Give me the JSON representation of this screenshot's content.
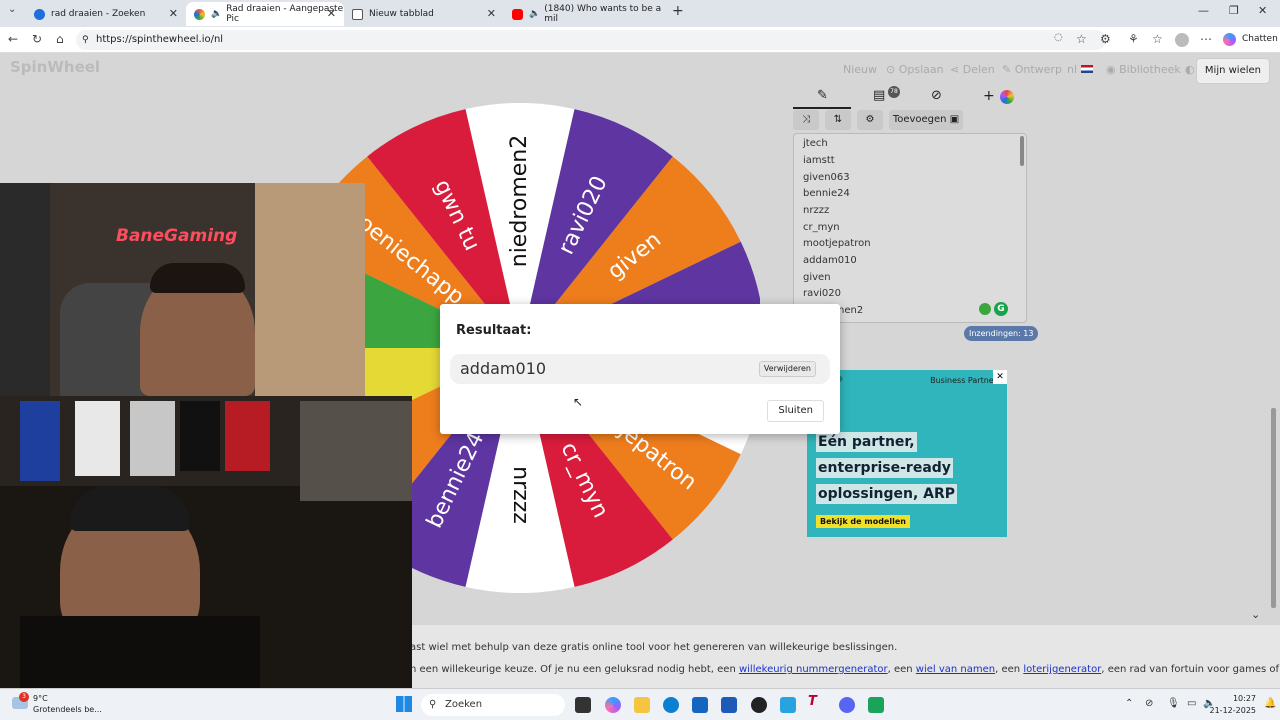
{
  "browser": {
    "tabs": [
      {
        "title": "rad draaien - Zoeken",
        "color": "#1e6fd9"
      },
      {
        "title": "Rad draaien - Aangepaste Pic",
        "color": "#e35d3c"
      },
      {
        "title": "Nieuw tabblad",
        "color": "#555555"
      },
      {
        "title": "(1840) Who wants to be a mil",
        "color": "#ff0000"
      }
    ],
    "url": "https://spinthewheel.io/nl",
    "copilot_label": "Chatten"
  },
  "site": {
    "logo": "SpinWheel",
    "nav": [
      "Nieuw",
      "Opslaan",
      "Delen",
      "Ontwerp",
      "Bibliotheek"
    ],
    "lang": "nl",
    "my_wheels": "Mijn wielen",
    "add_label": "Toevoegen",
    "entries": [
      "jtech",
      "iamstt",
      "given063",
      "bennie24",
      "nrzzz",
      "cr_myn",
      "mootjepatron",
      "addam010",
      "given",
      "ravi020",
      "niedromen2"
    ],
    "entries_count": "Inzendingen: 13",
    "notif_count": "78"
  },
  "wheel": {
    "segments": [
      {
        "label": "niedromen2",
        "color": "#ffffff"
      },
      {
        "label": "ravi020",
        "color": "#5e35a1"
      },
      {
        "label": "given",
        "color": "#ee7d1c"
      },
      {
        "label": "",
        "color": "#5e35a1"
      },
      {
        "label": "",
        "color": "#ffffff"
      },
      {
        "label": "mootjepatron",
        "color": "#ee7d1c"
      },
      {
        "label": "cr_myn",
        "color": "#d91c3b"
      },
      {
        "label": "nrzzz",
        "color": "#ffffff"
      },
      {
        "label": "bennie24",
        "color": "#5e35a1"
      },
      {
        "label": "",
        "color": "#ee7d1c"
      },
      {
        "label": "",
        "color": "#e5d935"
      },
      {
        "label": "",
        "color": "#3ba63f"
      },
      {
        "label": "poeniechapp",
        "color": "#ee7d1c"
      },
      {
        "label": "gwn tu",
        "color": "#d91c3b"
      }
    ]
  },
  "dialog": {
    "title": "Resultaat:",
    "result": "addam010",
    "remove_label": "Verwijderen",
    "close_label": "Sluiten"
  },
  "ad": {
    "partner": "Business Partner",
    "lines": [
      "Eén partner,",
      "enterprise-ready",
      "oplossingen, ARP"
    ],
    "cta": "Bekijk de modellen"
  },
  "footer": {
    "p1": "ast wiel met behulp van deze gratis online tool voor het genereren van willekeurige beslissingen.",
    "p2_a": "n een willekeurige keuze. Of je nu een geluksrad nodig hebt, een ",
    "link1": "willekeurig nummergenerator",
    "p2_b": ", een ",
    "link2": "wiel van namen",
    "p2_c": ", een ",
    "link3": "loterijgenerator",
    "p2_d": ", een rad van fortuin voor games of een simpele"
  },
  "webcam": {
    "neon_text": "BaneGaming"
  },
  "taskbar": {
    "weather_temp": "9°C",
    "weather_desc": "Grotendeels be...",
    "weather_badge": "3",
    "search": "Zoeken",
    "time": "10:27",
    "date": "21-12-2025"
  }
}
